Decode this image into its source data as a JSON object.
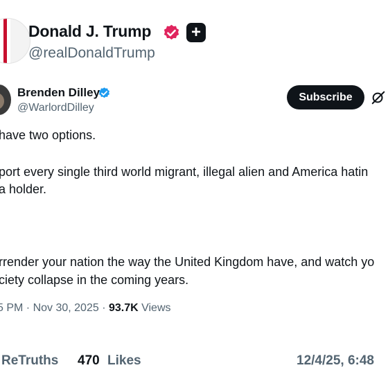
{
  "author": {
    "name": "Donald J. Trump",
    "handle": "@realDonaldTrump",
    "verified_color": "#e0245e"
  },
  "quoted_post": {
    "name": "Brenden Dilley",
    "handle": "@WarlordDilley",
    "verified_color": "#1d9bf0",
    "subscribe_label": "Subscribe",
    "lines": [
      "have two options.",
      "port every single third world migrant, illegal alien and America hatin",
      "a holder.",
      "rrender your nation the way the United Kingdom have, and watch yo",
      "ciety collapse in the coming years."
    ],
    "time_date": "5 PM · Nov 30, 2025 · ",
    "views_count": "93.7K",
    "views_label": " Views"
  },
  "footer": {
    "retruths_label": "ReTruths",
    "likes_count": "470",
    "likes_label": "Likes",
    "date": "12/4/25, 6:48"
  }
}
